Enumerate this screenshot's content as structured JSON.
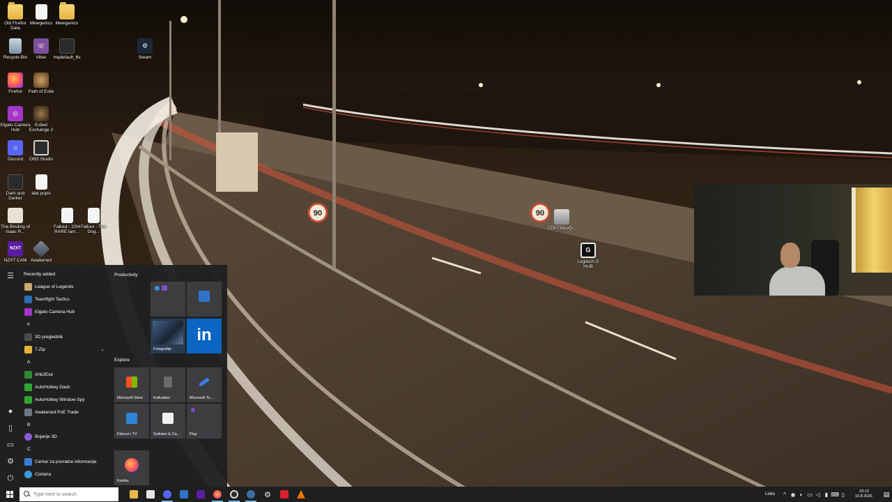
{
  "desktop": {
    "icons": [
      {
        "label": "Old Firefox Data",
        "icon": "folder-icon"
      },
      {
        "label": "Mewgenics",
        "icon": "file-icon"
      },
      {
        "label": "Mewgenics",
        "icon": "folder-icon"
      },
      {
        "label": "Recycle Bin",
        "icon": "recycle-bin-icon"
      },
      {
        "label": "Viber",
        "icon": "viber-icon"
      },
      {
        "label": "mqdefault_6s",
        "icon": "image-icon"
      },
      {
        "label": "Steam",
        "icon": "steam-icon"
      },
      {
        "label": "Firefox",
        "icon": "firefox-icon"
      },
      {
        "label": "Path of Exile",
        "icon": "path-of-exile-icon"
      },
      {
        "label": "Elgato Camera Hub",
        "icon": "elgato-icon"
      },
      {
        "label": "Exiled Exchange 2",
        "icon": "exiled-exchange-icon"
      },
      {
        "label": "Discord",
        "icon": "discord-icon"
      },
      {
        "label": "OBS Studio",
        "icon": "obs-icon"
      },
      {
        "label": "Dark and Darker",
        "icon": "dark-and-darker-icon"
      },
      {
        "label": "alat popis",
        "icon": "file-icon"
      },
      {
        "label": "The Binding of Isaac R...",
        "icon": "isaac-icon"
      },
      {
        "label": "Fallout - 2/04 RARE lam...",
        "icon": "file-icon"
      },
      {
        "label": "Fallout - The Dog...",
        "icon": "file-icon"
      },
      {
        "label": "NZXT CAM",
        "icon": "nzxt-icon"
      },
      {
        "label": "Awakened",
        "icon": "awakened-icon"
      },
      {
        "label": "CDhT34cvQ...",
        "icon": "image-icon"
      },
      {
        "label": "Logitech G HUB",
        "icon": "logitech-icon"
      }
    ],
    "speed_sign": "90"
  },
  "start_menu": {
    "recently_added_label": "Recently added",
    "apps": [
      {
        "label": "League of Legends",
        "color": "#c8aa6e"
      },
      {
        "label": "Teamfight Tactics",
        "color": "#2d6db5"
      },
      {
        "label": "Elgato Camera Hub",
        "color": "#a236c6"
      },
      {
        "letter": "#"
      },
      {
        "label": "3D preglednik",
        "color": "#4a4a4a"
      },
      {
        "label": "7-Zip",
        "color": "#e6b43e"
      },
      {
        "letter": "A"
      },
      {
        "label": "Ahk2Exe",
        "color": "#2d8b2d"
      },
      {
        "label": "AutoHotkey Dash",
        "color": "#2fa52f"
      },
      {
        "label": "AutoHotkey Window Spy",
        "color": "#2fa52f"
      },
      {
        "label": "Awakened PoE Trade",
        "color": "#6b7683"
      },
      {
        "letter": "B"
      },
      {
        "label": "Bojanje 3D",
        "color": "#8e5bd6"
      },
      {
        "letter": "C"
      },
      {
        "label": "Centar za povratne informacije",
        "color": "#3a7bd5"
      },
      {
        "label": "Cortana",
        "color": "#3a9bdc"
      }
    ],
    "groups": [
      {
        "title": "Productivity"
      },
      {
        "title": "Explore"
      }
    ],
    "tiles": {
      "fotografije": "Fotografije",
      "microsoft_store": "Microsoft Store",
      "kalkulator": "Kalkulator",
      "microsoft_todo": "Microsoft To...",
      "filmovi": "Filmovi i TV",
      "solitaire": "Solitaire & Ca...",
      "play": "Play",
      "firefox": "Firefox"
    }
  },
  "taskbar": {
    "search_placeholder": "Type here to search",
    "apps": [
      "file-explorer",
      "store",
      "obs",
      "mail",
      "nzxt",
      "firefox",
      "obs-studio",
      "steam",
      "settings",
      "red-app",
      "vlc"
    ],
    "tray_label": "Links",
    "time": "23:12",
    "date": "16.8.2026."
  }
}
